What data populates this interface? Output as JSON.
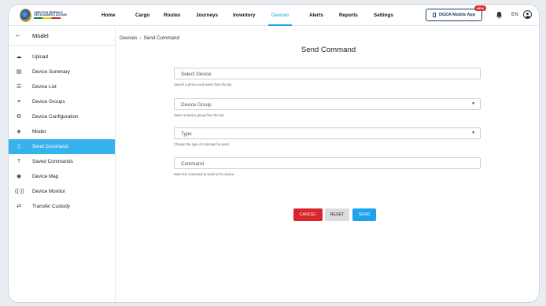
{
  "header": {
    "logo": {
      "line1": "DIRECTION GÉNÉRALE",
      "line2": "DES DOUANES & ACCISES"
    },
    "nav": [
      {
        "label": "Home",
        "active": false
      },
      {
        "label": "Cargo",
        "active": false
      },
      {
        "label": "Routes",
        "active": false
      },
      {
        "label": "Journeys",
        "active": false
      },
      {
        "label": "Inventory",
        "active": false
      },
      {
        "label": "Devices",
        "active": true
      },
      {
        "label": "Alerts",
        "active": false
      },
      {
        "label": "Reports",
        "active": false
      },
      {
        "label": "Settings",
        "active": false
      }
    ],
    "mobile_app_label": "DGDA Mobile App",
    "new_badge": "NEW",
    "language": "EN",
    "icons": {
      "bell": "bell-icon",
      "user": "user-icon",
      "phone": "phone-icon"
    }
  },
  "sidebar": {
    "title": "Model",
    "items": [
      {
        "label": "Upload",
        "icon": "cloud-upload-icon",
        "glyph": "☁",
        "active": false
      },
      {
        "label": "Device Summary",
        "icon": "document-icon",
        "glyph": "▤",
        "active": false
      },
      {
        "label": "Device List",
        "icon": "list-icon",
        "glyph": "☰",
        "active": false
      },
      {
        "label": "Device Groups",
        "icon": "group-list-icon",
        "glyph": "≡",
        "active": false
      },
      {
        "label": "Device Configuration",
        "icon": "settings-icon",
        "glyph": "⚙",
        "active": false
      },
      {
        "label": "Model",
        "icon": "model-icon",
        "glyph": "◈",
        "active": false
      },
      {
        "label": "Send Command",
        "icon": "send-command-icon",
        "glyph": "▯",
        "active": true
      },
      {
        "label": "Saved Commands",
        "icon": "save-icon",
        "glyph": "⤒",
        "active": false
      },
      {
        "label": "Device Map",
        "icon": "compass-icon",
        "glyph": "◉",
        "active": false
      },
      {
        "label": "Device Monitor",
        "icon": "monitor-icon",
        "glyph": "((·))",
        "active": false
      },
      {
        "label": "Transfer Custody",
        "icon": "transfer-icon",
        "glyph": "⇄",
        "active": false
      }
    ]
  },
  "breadcrumb": {
    "parent": "Devices",
    "separator": "›",
    "current": "Send Command"
  },
  "form": {
    "title": "Send Command",
    "device": {
      "placeholder": "Select Device",
      "helper": "Search a device and select from the list."
    },
    "device_group": {
      "placeholder": "Device Group",
      "helper": "Select a device group from the list."
    },
    "type": {
      "placeholder": "Type",
      "helper": "Choose the type of command to send."
    },
    "command": {
      "placeholder": "Command",
      "helper": "Enter the command to send to the device."
    },
    "buttons": {
      "cancel": "CANCEL",
      "reset": "RESET",
      "send": "SEND"
    }
  },
  "colors": {
    "accent": "#36b3ec",
    "cancel": "#d8262c",
    "send": "#1ca3ec",
    "brand": "#1d3c6e"
  }
}
